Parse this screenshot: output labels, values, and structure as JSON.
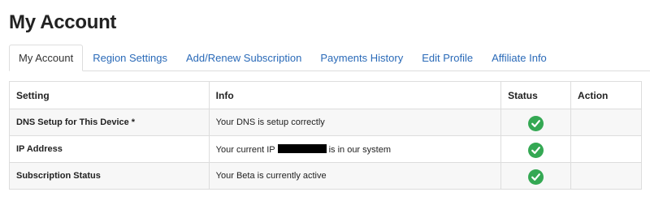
{
  "page_title": "My Account",
  "tabs": [
    {
      "label": "My Account",
      "active": true
    },
    {
      "label": "Region Settings",
      "active": false
    },
    {
      "label": "Add/Renew Subscription",
      "active": false
    },
    {
      "label": "Payments History",
      "active": false
    },
    {
      "label": "Edit Profile",
      "active": false
    },
    {
      "label": "Affiliate Info",
      "active": false
    }
  ],
  "table": {
    "headers": {
      "setting": "Setting",
      "info": "Info",
      "status": "Status",
      "action": "Action"
    },
    "rows": [
      {
        "setting": "DNS Setup for This Device *",
        "info": "Your DNS is setup correctly",
        "status_icon": "check-icon",
        "action": ""
      },
      {
        "setting": "IP Address",
        "info_before": "Your current IP",
        "info_after": "is in our system",
        "status_icon": "check-icon",
        "action": ""
      },
      {
        "setting": "Subscription Status",
        "info": "Your Beta is currently active",
        "status_icon": "check-icon",
        "action": ""
      }
    ]
  },
  "colors": {
    "link": "#2a6ab8",
    "check": "#34a853",
    "border": "#dddddd",
    "row_stripe": "#f7f7f7"
  }
}
